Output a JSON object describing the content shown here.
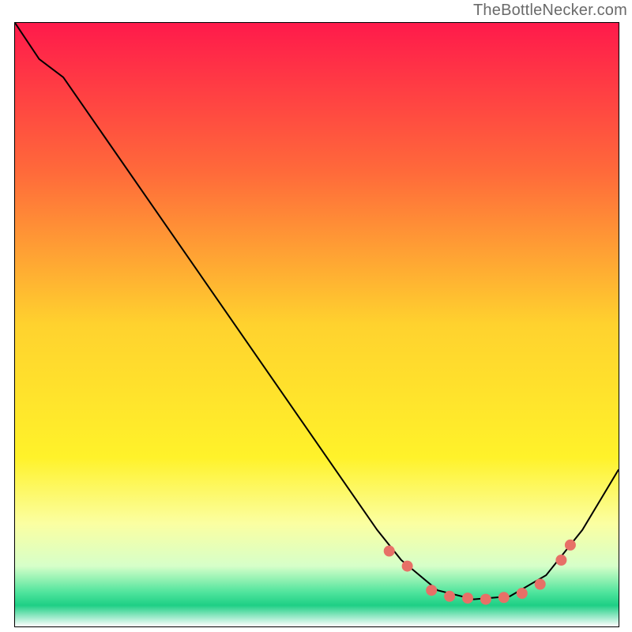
{
  "attribution": "TheBottleNecker.com",
  "chart_data": {
    "type": "line",
    "title": "",
    "xlabel": "",
    "ylabel": "",
    "xlim": [
      0,
      100
    ],
    "ylim": [
      0,
      100
    ],
    "background": {
      "type": "vertical-gradient",
      "stops": [
        {
          "offset": 0.0,
          "color": "#ff1a4b"
        },
        {
          "offset": 0.25,
          "color": "#ff6b3a"
        },
        {
          "offset": 0.5,
          "color": "#ffd22e"
        },
        {
          "offset": 0.72,
          "color": "#fff22a"
        },
        {
          "offset": 0.83,
          "color": "#fbffa2"
        },
        {
          "offset": 0.9,
          "color": "#d6ffc9"
        },
        {
          "offset": 0.945,
          "color": "#4be39b"
        },
        {
          "offset": 0.965,
          "color": "#1ecf85"
        },
        {
          "offset": 1.0,
          "color": "#ffffff"
        }
      ]
    },
    "series": [
      {
        "name": "curve",
        "stroke": "#000000",
        "stroke_width": 2,
        "points": [
          {
            "x": 0,
            "y": 100
          },
          {
            "x": 4,
            "y": 94
          },
          {
            "x": 8,
            "y": 91
          },
          {
            "x": 60,
            "y": 16
          },
          {
            "x": 64,
            "y": 11
          },
          {
            "x": 70,
            "y": 6
          },
          {
            "x": 76,
            "y": 4.5
          },
          {
            "x": 82,
            "y": 5
          },
          {
            "x": 88,
            "y": 8.5
          },
          {
            "x": 94,
            "y": 16
          },
          {
            "x": 100,
            "y": 26
          }
        ]
      }
    ],
    "markers": {
      "color": "#e77067",
      "radius": 7,
      "points": [
        {
          "x": 62,
          "y": 12.5
        },
        {
          "x": 65,
          "y": 10
        },
        {
          "x": 69,
          "y": 6
        },
        {
          "x": 72,
          "y": 5
        },
        {
          "x": 75,
          "y": 4.7
        },
        {
          "x": 78,
          "y": 4.5
        },
        {
          "x": 81,
          "y": 4.8
        },
        {
          "x": 84,
          "y": 5.5
        },
        {
          "x": 87,
          "y": 7
        },
        {
          "x": 90.5,
          "y": 11
        },
        {
          "x": 92,
          "y": 13.5
        }
      ]
    },
    "grid": false,
    "legend": false
  }
}
